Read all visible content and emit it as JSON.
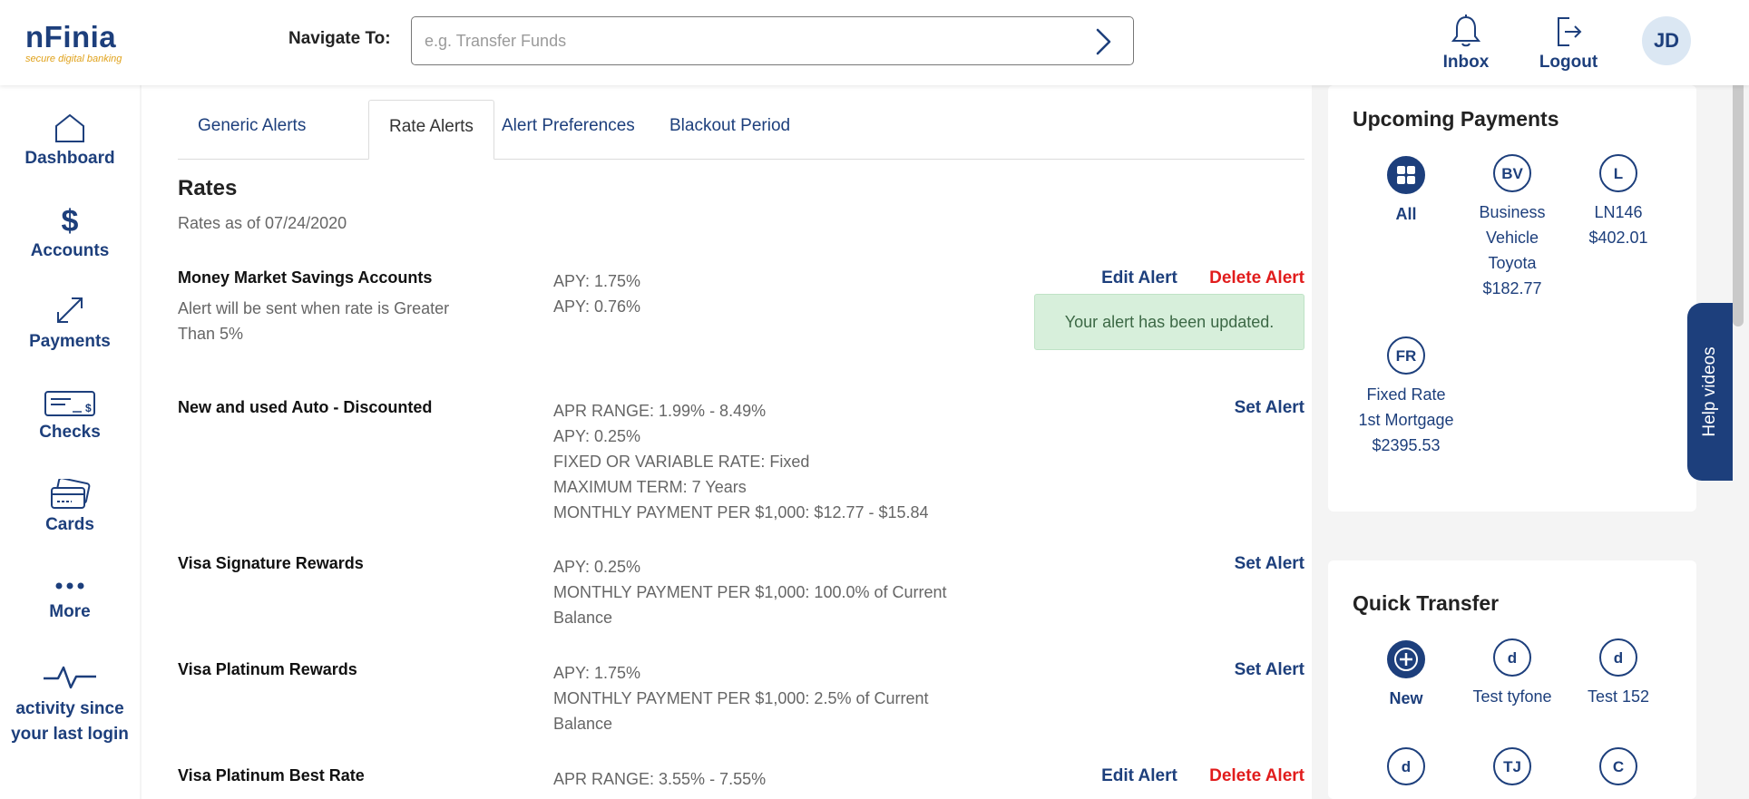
{
  "header": {
    "logo_main": "nFinia",
    "logo_tag": "secure digital banking",
    "navigate_label": "Navigate To:",
    "navigate_placeholder": "e.g. Transfer Funds",
    "inbox": "Inbox",
    "logout": "Logout",
    "avatar": "JD"
  },
  "sidebar": {
    "dashboard": "Dashboard",
    "accounts": "Accounts",
    "payments": "Payments",
    "checks": "Checks",
    "cards": "Cards",
    "more": "More",
    "activity": "activity since your last login"
  },
  "tabs": [
    "Generic Alerts",
    "Rate Alerts",
    "Alert Preferences",
    "Blackout Period"
  ],
  "rates": {
    "title": "Rates",
    "as_of": "Rates as of 07/24/2020",
    "rows": [
      {
        "name": "Money Market Savings Accounts",
        "note": "Alert will be sent when rate is Greater Than 5%",
        "details": [
          "APY: 1.75%",
          "APY: 0.76%"
        ],
        "action1": "Edit Alert",
        "action2": "Delete Alert",
        "toast": "Your alert has been updated."
      },
      {
        "name": "New and used Auto - Discounted",
        "details": [
          "APR RANGE: 1.99% - 8.49%",
          "APY: 0.25%",
          "FIXED OR VARIABLE RATE: Fixed",
          "MAXIMUM TERM: 7 Years",
          "MONTHLY PAYMENT PER $1,000: $12.77 - $15.84"
        ],
        "action1": "Set Alert"
      },
      {
        "name": "Visa Signature Rewards",
        "details": [
          "APY: 0.25%",
          "MONTHLY PAYMENT PER $1,000: 100.0% of Current Balance"
        ],
        "action1": "Set Alert"
      },
      {
        "name": "Visa Platinum Rewards",
        "details": [
          "APY: 1.75%",
          "MONTHLY PAYMENT PER $1,000: 2.5% of Current Balance"
        ],
        "action1": "Set Alert"
      },
      {
        "name": "Visa Platinum Best Rate",
        "details": [
          "APR RANGE: 3.55% - 7.55%"
        ],
        "action1": "Edit Alert",
        "action2": "Delete Alert"
      }
    ]
  },
  "upcoming": {
    "title": "Upcoming Payments",
    "all": "All",
    "items": [
      {
        "badge": "BV",
        "lines": [
          "Business",
          "Vehicle",
          "Toyota"
        ],
        "amount": "$182.77"
      },
      {
        "badge": "L",
        "lines": [
          "LN146"
        ],
        "amount": "$402.01"
      },
      {
        "badge": "FR",
        "lines": [
          "Fixed Rate",
          "1st Mortgage"
        ],
        "amount": "$2395.53"
      }
    ]
  },
  "quick_transfer": {
    "title": "Quick Transfer",
    "new": "New",
    "items": [
      {
        "badge": "d",
        "label": "Test tyfone"
      },
      {
        "badge": "d",
        "label": "Test 152"
      },
      {
        "badge": "d"
      },
      {
        "badge": "TJ"
      },
      {
        "badge": "C"
      }
    ]
  },
  "help": "Help videos",
  "colors": {
    "brand": "#1d3f7c",
    "accent": "#e0a21b",
    "danger": "#e11c1c",
    "success_bg": "#d7efdb"
  }
}
